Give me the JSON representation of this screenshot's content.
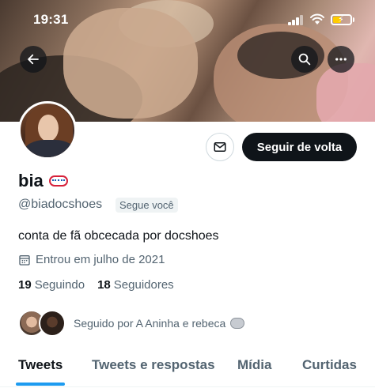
{
  "status_bar": {
    "time": "19:31"
  },
  "header": {
    "back_icon": "arrow-left-icon",
    "search_icon": "search-icon",
    "more_icon": "more-horizontal-icon"
  },
  "profile": {
    "display_name": "bia",
    "name_emoji": "emoji-badge",
    "handle": "@biadocshoes",
    "follows_you_label": "Segue você",
    "bio": "conta de fã obcecada por docshoes",
    "joined": "Entrou em julho de 2021",
    "following_count": "19",
    "following_label": "Seguindo",
    "followers_count": "18",
    "followers_label": "Seguidores",
    "followed_by": "Seguido por A Aninha e rebeca"
  },
  "actions": {
    "message_icon": "mail-icon",
    "follow_back_label": "Seguir de volta"
  },
  "tabs": [
    {
      "label": "Tweets",
      "active": true
    },
    {
      "label": "Tweets e respostas",
      "active": false
    },
    {
      "label": "Mídia",
      "active": false
    },
    {
      "label": "Curtidas",
      "active": false
    }
  ],
  "colors": {
    "accent": "#1d9bf0",
    "text": "#0f1419",
    "muted": "#536471",
    "button_dark": "#0f1419"
  }
}
